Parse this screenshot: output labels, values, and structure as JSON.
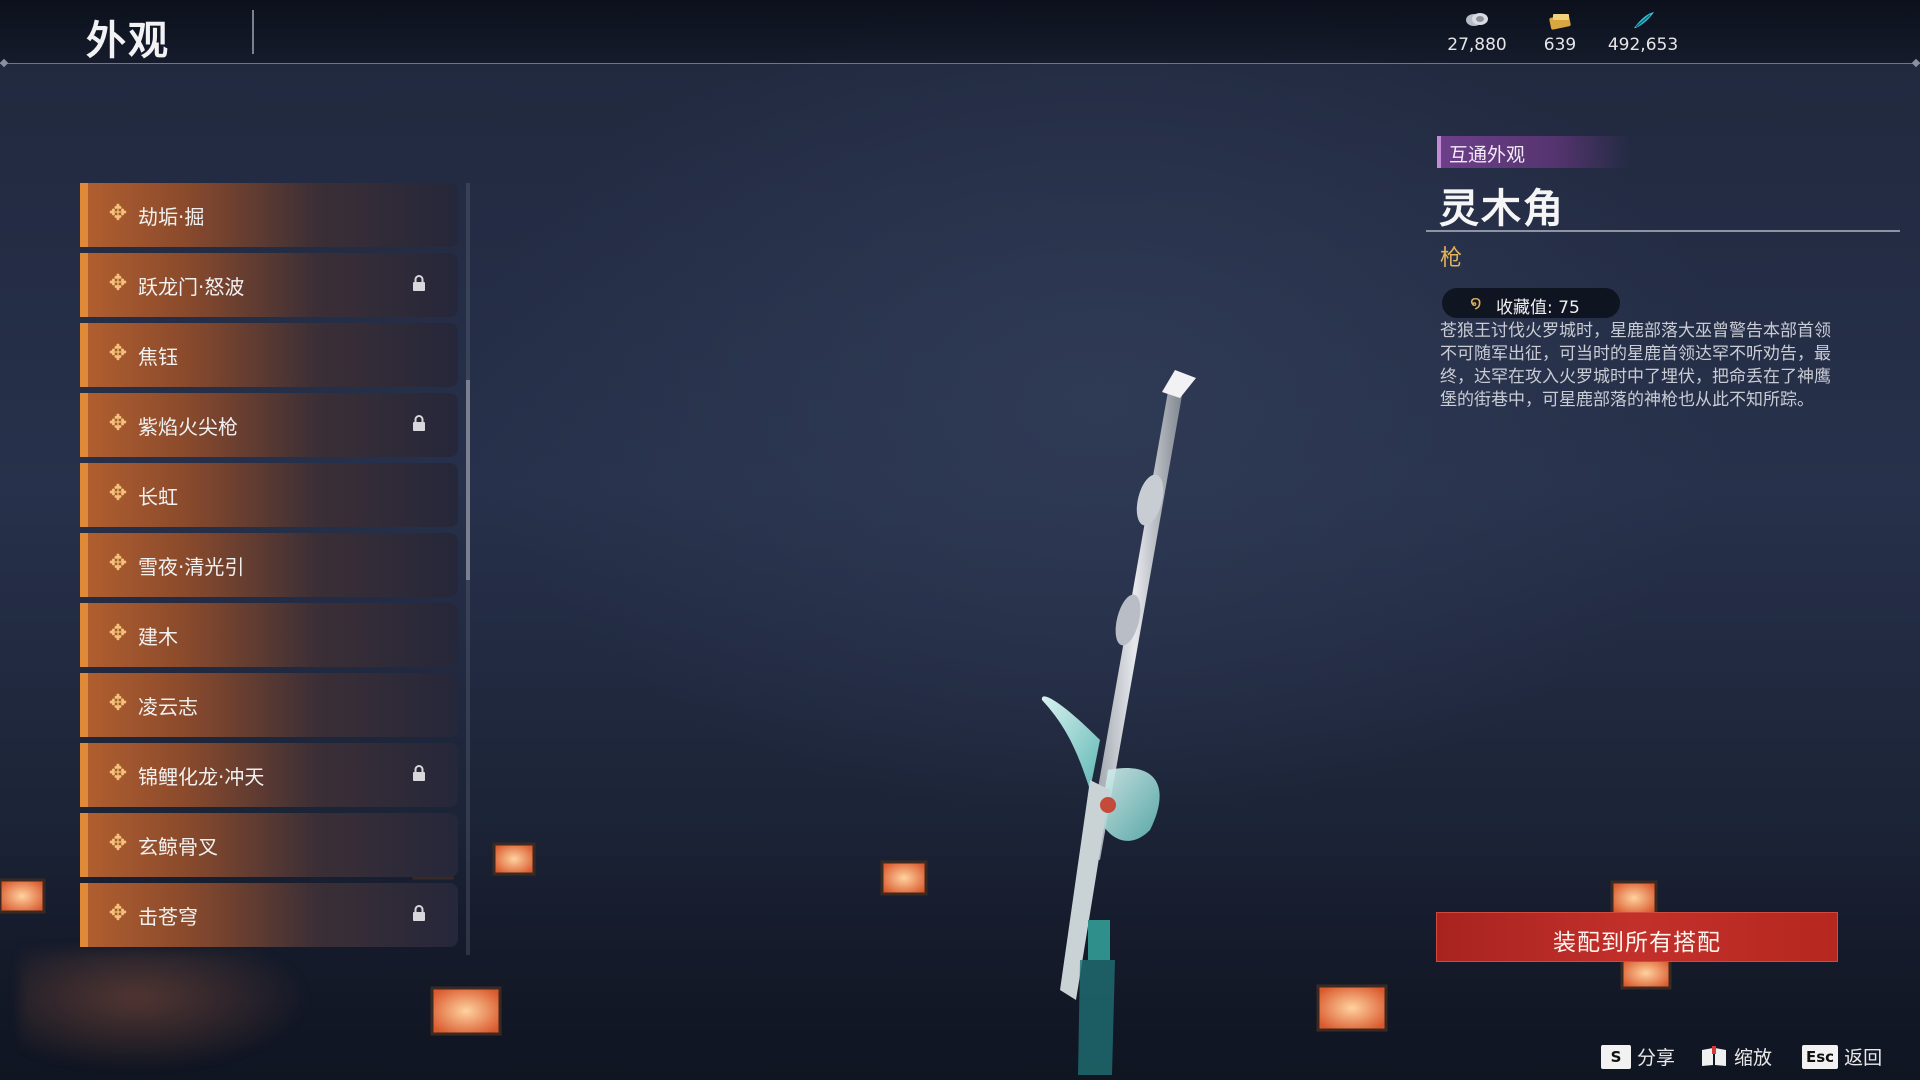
{
  "header": {
    "title": "外观",
    "currencies": [
      {
        "icon": "coin-stack-icon",
        "value": "27,880"
      },
      {
        "icon": "gold-ticket-icon",
        "value": "639"
      },
      {
        "icon": "feather-icon",
        "value": "492,653"
      }
    ]
  },
  "list": {
    "items": [
      {
        "label": "劫垢·掘",
        "locked": false
      },
      {
        "label": "跃龙门·怒波",
        "locked": true
      },
      {
        "label": "焦钰",
        "locked": false
      },
      {
        "label": "紫焰火尖枪",
        "locked": true
      },
      {
        "label": "长虹",
        "locked": false
      },
      {
        "label": "雪夜·清光引",
        "locked": false
      },
      {
        "label": "建木",
        "locked": false
      },
      {
        "label": "凌云志",
        "locked": false
      },
      {
        "label": "锦鲤化龙·冲天",
        "locked": true
      },
      {
        "label": "玄鲸骨叉",
        "locked": false
      },
      {
        "label": "击苍穹",
        "locked": true
      }
    ]
  },
  "detail": {
    "tag": "互通外观",
    "name": "灵木角",
    "type": "枪",
    "collect_label": "收藏值: 75",
    "description": "苍狼王讨伐火罗城时，星鹿部落大巫曾警告本部首领不可随军出征，可当时的星鹿首领达罕不听劝告，最终，达罕在攻入火罗城时中了埋伏，把命丢在了神鹰堡的街巷中，可星鹿部落的神枪也从此不知所踪。",
    "equip_button": "装配到所有搭配"
  },
  "footer": {
    "share_key": "S",
    "share_label": "分享",
    "zoom_label": "缩放",
    "back_key": "Esc",
    "back_label": "返回"
  },
  "colors": {
    "accent_orange": "#e08a38",
    "tag_purple": "#6d3f8a",
    "equip_red": "#c3302b",
    "type_gold": "#e3b258"
  }
}
